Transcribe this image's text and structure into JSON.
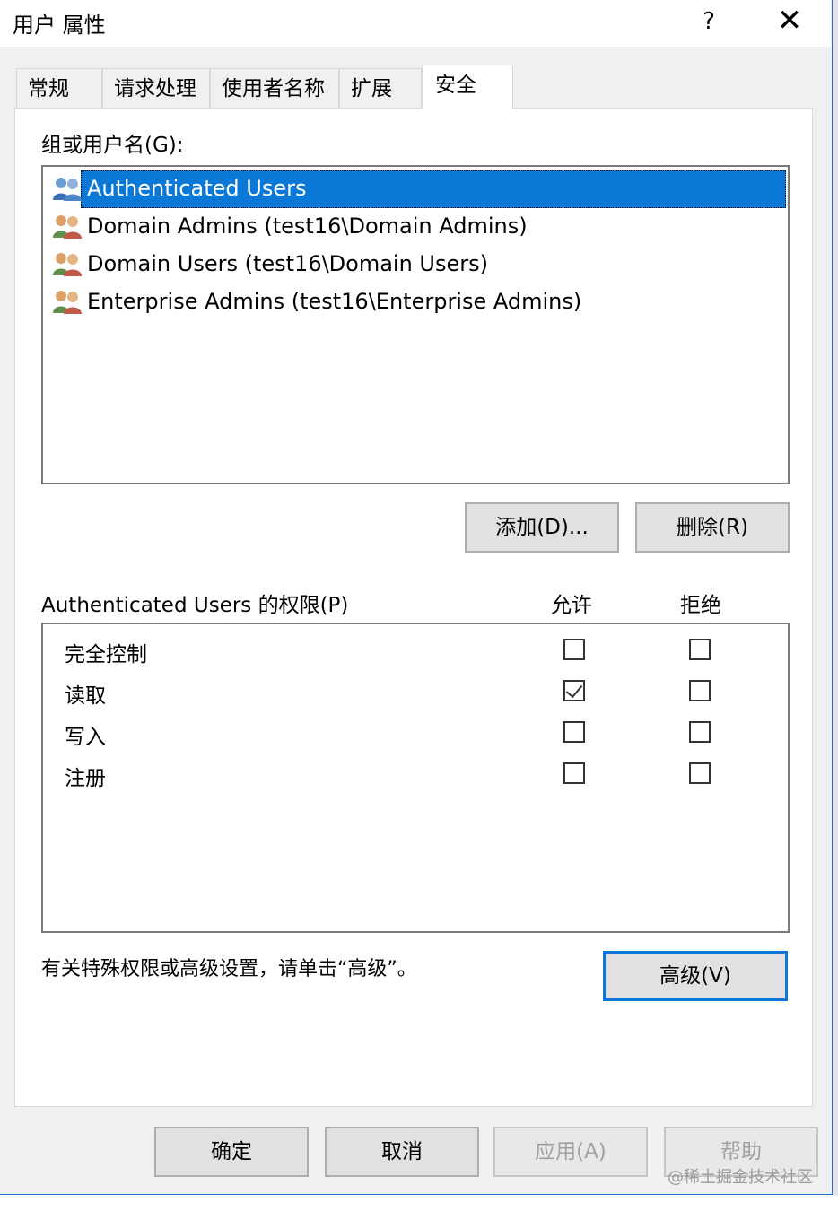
{
  "window": {
    "title": "用户 属性",
    "help_label": "?",
    "close_label": "✕"
  },
  "tabs": [
    {
      "label": "常规"
    },
    {
      "label": "请求处理"
    },
    {
      "label": "使用者名称"
    },
    {
      "label": "扩展"
    },
    {
      "label": "安全",
      "active": true
    }
  ],
  "security": {
    "groups_label": "组或用户名(G):",
    "users": [
      {
        "name": "Authenticated Users",
        "selected": true
      },
      {
        "name": "Domain Admins (test16\\Domain Admins)"
      },
      {
        "name": "Domain Users (test16\\Domain Users)"
      },
      {
        "name": "Enterprise Admins (test16\\Enterprise Admins)"
      }
    ],
    "add_button": "添加(D)...",
    "remove_button": "删除(R)",
    "permissions_label": "Authenticated Users 的权限(P)",
    "allow_header": "允许",
    "deny_header": "拒绝",
    "permissions": [
      {
        "name": "完全控制",
        "allow": false,
        "deny": false
      },
      {
        "name": "读取",
        "allow": true,
        "deny": false
      },
      {
        "name": "写入",
        "allow": false,
        "deny": false
      },
      {
        "name": "注册",
        "allow": false,
        "deny": false
      }
    ],
    "advanced_hint": "有关特殊权限或高级设置，请单击“高级”。",
    "advanced_button": "高级(V)"
  },
  "footer": {
    "ok": "确定",
    "cancel": "取消",
    "apply": "应用(A)",
    "help": "帮助"
  },
  "watermark": "@稀土掘金技术社区",
  "colors": {
    "selection": "#0a78d7",
    "dialog_bg": "#f0f0f0",
    "accent_border": "#0a78d7"
  }
}
